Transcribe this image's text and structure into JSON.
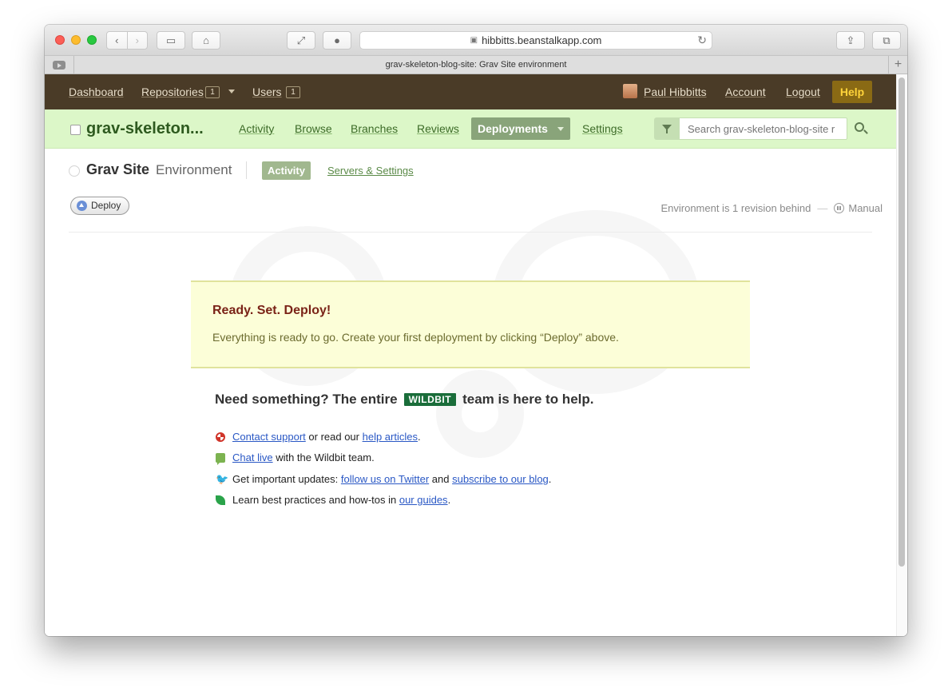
{
  "browser": {
    "url": "hibbitts.beanstalkapp.com",
    "tab_title": "grav-skeleton-blog-site: Grav Site environment"
  },
  "topnav": {
    "dashboard": "Dashboard",
    "repositories": "Repositories",
    "repositories_count": "1",
    "users": "Users",
    "users_count": "1",
    "user_name": "Paul Hibbitts",
    "account": "Account",
    "logout": "Logout",
    "help": "Help"
  },
  "repobar": {
    "repo_name": "grav-skeleton...",
    "nav": [
      "Activity",
      "Browse",
      "Branches",
      "Reviews"
    ],
    "active_tab": "Deployments",
    "settings": "Settings",
    "search_placeholder": "Search grav-skeleton-blog-site r"
  },
  "environment": {
    "name": "Grav Site",
    "type": "Environment",
    "tab_activity": "Activity",
    "tab_servers": "Servers & Settings",
    "deploy_button": "Deploy",
    "status": "Environment is 1 revision behind",
    "dash": "—",
    "mode": "Manual"
  },
  "notice": {
    "title": "Ready. Set. Deploy!",
    "text": "Everything is ready to go. Create your first deployment by clicking “Deploy” above."
  },
  "help": {
    "heading_pre": "Need something? The entire",
    "brand": "WILDBIT",
    "heading_post": "team is here to help.",
    "line1": {
      "link1": "Contact support",
      "text1": " or read our ",
      "link2": "help articles",
      "text2": "."
    },
    "line2": {
      "link1": "Chat live",
      "text1": " with the Wildbit team."
    },
    "line3": {
      "text0": "Get important updates: ",
      "link1": "follow us on Twitter",
      "text1": " and ",
      "link2": "subscribe to our blog",
      "text2": "."
    },
    "line4": {
      "text0": "Learn best practices and how-tos in ",
      "link1": "our guides",
      "text1": "."
    }
  },
  "colors": {
    "topnav_bg": "#4a3b27",
    "repobar_bg": "#dcf7c8",
    "help_button": "#8a6a14",
    "notice_bg": "#fcfed8",
    "brand_green": "#1a6d3a"
  },
  "icons": [
    "close-icon",
    "minimize-icon",
    "zoom-icon",
    "back-icon",
    "forward-icon",
    "sidebar-icon",
    "home-icon",
    "fullscreen-icon",
    "ghost-icon",
    "lock-icon",
    "reload-icon",
    "share-icon",
    "tabs-icon",
    "filter-icon",
    "search-icon",
    "lifebuoy-icon",
    "chat-icon",
    "twitter-icon",
    "leaf-icon"
  ]
}
